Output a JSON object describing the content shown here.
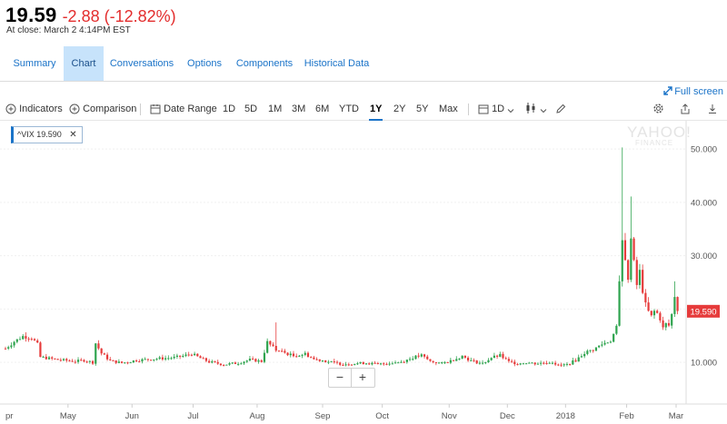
{
  "quote": {
    "price": "19.59",
    "change": "-2.88 (-12.82%)",
    "close_time": "At close: March 2 4:14PM EST"
  },
  "tabs": [
    {
      "label": "Summary",
      "active": false
    },
    {
      "label": "Chart",
      "active": true
    },
    {
      "label": "Conversations",
      "active": false
    },
    {
      "label": "Options",
      "active": false
    },
    {
      "label": "Components",
      "active": false
    },
    {
      "label": "Historical Data",
      "active": false
    }
  ],
  "toolbar": {
    "indicators": "Indicators",
    "comparison": "Comparison",
    "date_range": "Date Range",
    "ranges": [
      "1D",
      "5D",
      "1M",
      "3M",
      "6M",
      "YTD",
      "1Y",
      "2Y",
      "5Y",
      "Max"
    ],
    "selected_range": "1Y",
    "interval": "1D",
    "fullscreen": "Full screen"
  },
  "legend": {
    "symbol": "^VIX",
    "value": "19.590"
  },
  "watermark": {
    "line1": "YAHOO!",
    "line2": "FINANCE"
  },
  "zoom": {
    "minus": "−",
    "plus": "+"
  },
  "colors": {
    "up": "#2fa44f",
    "down": "#e63b3b",
    "accent": "#1a73c8",
    "price_badge": "#e63b3b"
  },
  "icons": [
    "indicators-plus-icon",
    "comparison-plus-icon",
    "calendar-icon",
    "candlestick-icon",
    "pencil-icon",
    "settings-gear-icon",
    "share-icon",
    "download-icon",
    "fullscreen-icon",
    "close-icon"
  ],
  "chart_data": {
    "type": "candlestick",
    "title": "",
    "symbol": "^VIX",
    "last_value": 19.59,
    "y_ticks": [
      "50.000",
      "40.000",
      "30.000",
      "20.000",
      "10.000"
    ],
    "y_tick_values": [
      50,
      40,
      30,
      20,
      10
    ],
    "ylim": [
      2.2,
      55.3
    ],
    "x_ticks": [
      "pr",
      "May",
      "Jun",
      "Jul",
      "Aug",
      "Sep",
      "Oct",
      "Nov",
      "Dec",
      "2018",
      "Feb",
      "Mar"
    ],
    "x_tick_positions": [
      0,
      21.5,
      43.5,
      64.5,
      86.5,
      109,
      129.5,
      152.5,
      172.5,
      192.5,
      213.5,
      230.5
    ],
    "x_domain": [
      0,
      233
    ],
    "grid": true,
    "close_series": [
      [
        0,
        12.6
      ],
      [
        3,
        13.9
      ],
      [
        6,
        14.9
      ],
      [
        9,
        14.6
      ],
      [
        11,
        13.4
      ],
      [
        12,
        11.0
      ],
      [
        18,
        10.5
      ],
      [
        24,
        10.2
      ],
      [
        27,
        10.4
      ],
      [
        30,
        10.0
      ],
      [
        31,
        13.6
      ],
      [
        33,
        11.7
      ],
      [
        36,
        10.3
      ],
      [
        40,
        9.9
      ],
      [
        45,
        10.4
      ],
      [
        52,
        10.7
      ],
      [
        58,
        10.9
      ],
      [
        61,
        11.2
      ],
      [
        64,
        11.6
      ],
      [
        67,
        10.8
      ],
      [
        70,
        10.1
      ],
      [
        75,
        9.6
      ],
      [
        80,
        9.9
      ],
      [
        84,
        10.5
      ],
      [
        88,
        10.2
      ],
      [
        90,
        13.8
      ],
      [
        93,
        12.3
      ],
      [
        96,
        11.8
      ],
      [
        99,
        11.2
      ],
      [
        103,
        11.6
      ],
      [
        106,
        10.6
      ],
      [
        109,
        10.4
      ],
      [
        112,
        10.0
      ],
      [
        116,
        9.7
      ],
      [
        120,
        9.8
      ],
      [
        124,
        9.9
      ],
      [
        128,
        9.6
      ],
      [
        132,
        9.9
      ],
      [
        136,
        10.1
      ],
      [
        140,
        10.9
      ],
      [
        143,
        11.3
      ],
      [
        146,
        10.2
      ],
      [
        150,
        9.8
      ],
      [
        153,
        10.3
      ],
      [
        157,
        11.2
      ],
      [
        160,
        10.3
      ],
      [
        164,
        9.8
      ],
      [
        167,
        10.9
      ],
      [
        170,
        11.3
      ],
      [
        173,
        10.1
      ],
      [
        176,
        9.8
      ],
      [
        179,
        10.0
      ],
      [
        182,
        9.8
      ],
      [
        185,
        9.9
      ],
      [
        188,
        10.1
      ],
      [
        190,
        9.4
      ],
      [
        193,
        9.6
      ],
      [
        196,
        10.4
      ],
      [
        199,
        11.8
      ],
      [
        202,
        12.4
      ],
      [
        205,
        13.4
      ],
      [
        208,
        14.1
      ],
      [
        210,
        16.5
      ],
      [
        212,
        33.5
      ],
      [
        213,
        29.8
      ],
      [
        214,
        25.6
      ],
      [
        215,
        33.0
      ],
      [
        216,
        28.6
      ],
      [
        217,
        24.5
      ],
      [
        218,
        27.0
      ],
      [
        219,
        23.5
      ],
      [
        220,
        20.8
      ],
      [
        221,
        19.5
      ],
      [
        222,
        18.6
      ],
      [
        223,
        19.6
      ],
      [
        224,
        19.2
      ],
      [
        225,
        18.2
      ],
      [
        226,
        16.4
      ],
      [
        227,
        17.2
      ],
      [
        228,
        16.9
      ],
      [
        229,
        19.0
      ],
      [
        230,
        22.5
      ],
      [
        231,
        19.6
      ]
    ],
    "spikes": [
      [
        212,
        50.3
      ],
      [
        215,
        41.1
      ],
      [
        230,
        25.2
      ],
      [
        93,
        17.5
      ]
    ]
  }
}
